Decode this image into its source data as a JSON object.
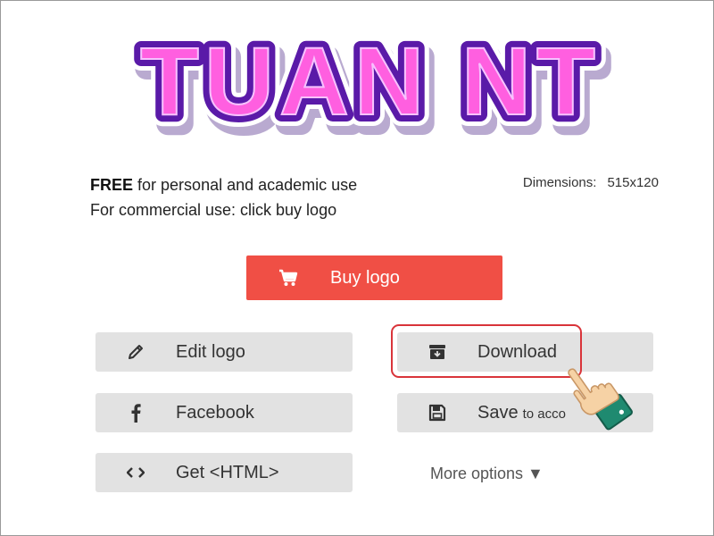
{
  "logo": {
    "text": "TUAN NT",
    "fill": "#ff5fe0",
    "outline": "#5a1aa8",
    "stroke_white": "#ffffff"
  },
  "license": {
    "free_word": "FREE",
    "free_rest": "for personal and academic use",
    "commercial": "For commercial use: click buy logo"
  },
  "dimensions": {
    "label": "Dimensions:",
    "value": "515x120"
  },
  "buy_button": {
    "label": "Buy logo",
    "icon": "cart-icon",
    "color": "#f04f45"
  },
  "actions": {
    "edit": {
      "label": "Edit logo",
      "icon": "pencil-icon"
    },
    "facebook": {
      "label": "Facebook",
      "icon": "facebook-icon"
    },
    "html": {
      "label": "Get <HTML>",
      "icon": "code-icon"
    },
    "download": {
      "label": "Download",
      "icon": "download-box-icon"
    },
    "save": {
      "label": "Save",
      "suffix": "to acco",
      "icon": "floppy-disk-icon"
    }
  },
  "more_options": {
    "label": "More options ▼"
  },
  "highlight_color": "#d9343a",
  "pointer": {
    "icon": "pointing-hand-icon"
  }
}
